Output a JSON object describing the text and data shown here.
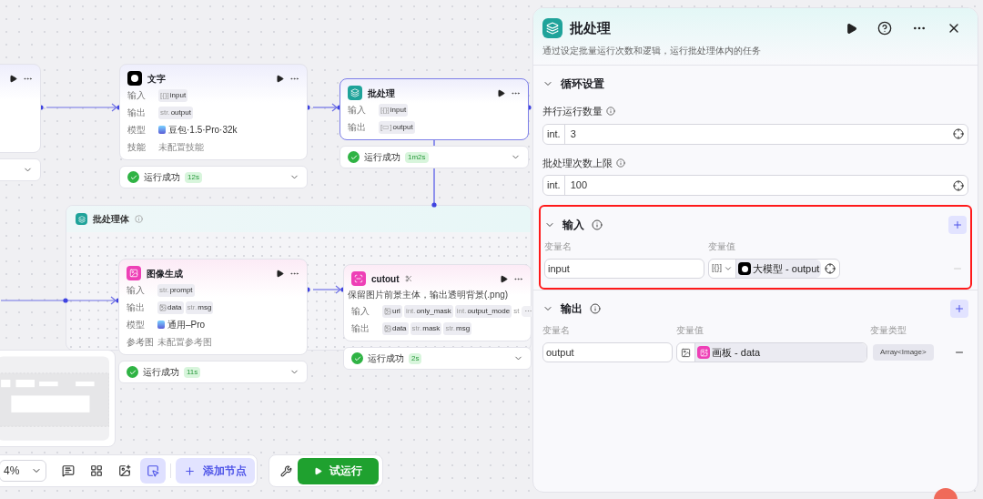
{
  "canvas": {
    "nodes": [
      {
        "kind": "partial",
        "selected": false,
        "status": {
          "success": false
        }
      },
      {
        "kind": "llm",
        "title": "文字",
        "selected": false,
        "rows": [
          {
            "kind": "params",
            "label": "输入",
            "params": [
              {
                "type": "[{}]",
                "name": "input"
              }
            ]
          },
          {
            "kind": "params",
            "label": "输出",
            "params": [
              {
                "type": "str.",
                "name": "output"
              }
            ]
          },
          {
            "kind": "model",
            "label": "模型",
            "value": "豆包·1.5·Pro·32k"
          },
          {
            "kind": "placeholder",
            "label": "技能",
            "value": "未配置技能"
          }
        ],
        "status": {
          "success": true,
          "text": "运行成功",
          "time": "12s"
        }
      },
      {
        "kind": "batch",
        "title": "批处理",
        "selected": true,
        "rows": [
          {
            "kind": "params",
            "label": "输入",
            "params": [
              {
                "type": "[{}]",
                "name": "input"
              }
            ]
          },
          {
            "kind": "params",
            "label": "输出",
            "params": [
              {
                "type": "[▭]",
                "name": "output"
              }
            ]
          }
        ],
        "status": {
          "success": true,
          "text": "运行成功",
          "time": "1m2s"
        }
      },
      {
        "kind": "image",
        "title": "图像生成",
        "selected": false,
        "rows": [
          {
            "kind": "params",
            "label": "输入",
            "params": [
              {
                "type": "str.",
                "name": "prompt"
              }
            ]
          },
          {
            "kind": "params",
            "label": "输出",
            "params": [
              {
                "kind": "image",
                "name": "data"
              },
              {
                "type": "str.",
                "name": "msg"
              }
            ]
          },
          {
            "kind": "model",
            "label": "模型",
            "value": "通用–Pro"
          },
          {
            "kind": "placeholder",
            "label": "参考图",
            "value": "未配置参考图"
          }
        ],
        "status": {
          "success": true,
          "text": "运行成功",
          "time": "11s"
        }
      },
      {
        "kind": "cutout",
        "title": "cutout",
        "selected": false,
        "description": "保留图片前景主体，输出透明背景(.png)",
        "rows": [
          {
            "kind": "params",
            "label": "输入",
            "more": "···",
            "params": [
              {
                "kind": "image",
                "name": "url"
              },
              {
                "type": "int.",
                "name": "only_mask"
              },
              {
                "type": "int.",
                "name": "output_mode"
              },
              {
                "kind": "cut",
                "type": "st"
              }
            ]
          },
          {
            "kind": "params",
            "label": "输出",
            "params": [
              {
                "kind": "image",
                "name": "data"
              },
              {
                "type": "str.",
                "name": "mask"
              },
              {
                "type": "str.",
                "name": "msg"
              }
            ]
          }
        ],
        "status": {
          "success": true,
          "text": "运行成功",
          "time": "2s"
        }
      }
    ],
    "group": {
      "title": "批处理体"
    },
    "toolbar": {
      "zoom": "4%",
      "tools": [
        {
          "kind": "comment",
          "selected": false
        },
        {
          "kind": "grid",
          "selected": false
        },
        {
          "kind": "image",
          "selected": false
        },
        {
          "kind": "select",
          "selected": true
        }
      ],
      "add_button": "添加节点",
      "run_button": "试运行"
    }
  },
  "panel": {
    "title": "批处理",
    "description": "通过设定批量运行次数和逻辑，运行批处理体内的任务",
    "sections": [
      {
        "kind": "settings",
        "title": "循环设置",
        "expanded": true,
        "highlighted": false,
        "fields": [
          {
            "label": "并行运行数量",
            "type": "int.",
            "value": "3"
          },
          {
            "label": "批处理次数上限",
            "type": "int.",
            "value": "100"
          }
        ]
      },
      {
        "kind": "vars",
        "title": "输入",
        "expanded": true,
        "highlighted": true,
        "columns": [
          "变量名",
          "变量值"
        ],
        "rows": [
          {
            "kind": "typed",
            "name": "input",
            "type": "[{}]",
            "source": "大模型 - output",
            "disabled": true
          }
        ]
      },
      {
        "kind": "vars",
        "title": "输出",
        "expanded": true,
        "highlighted": false,
        "columns": [
          "变量名",
          "变量值",
          "变量类型"
        ],
        "rows": [
          {
            "kind": "image",
            "name": "output",
            "source": "画板 - data",
            "var_type": "Array<Image>",
            "disabled": false
          }
        ]
      }
    ]
  }
}
